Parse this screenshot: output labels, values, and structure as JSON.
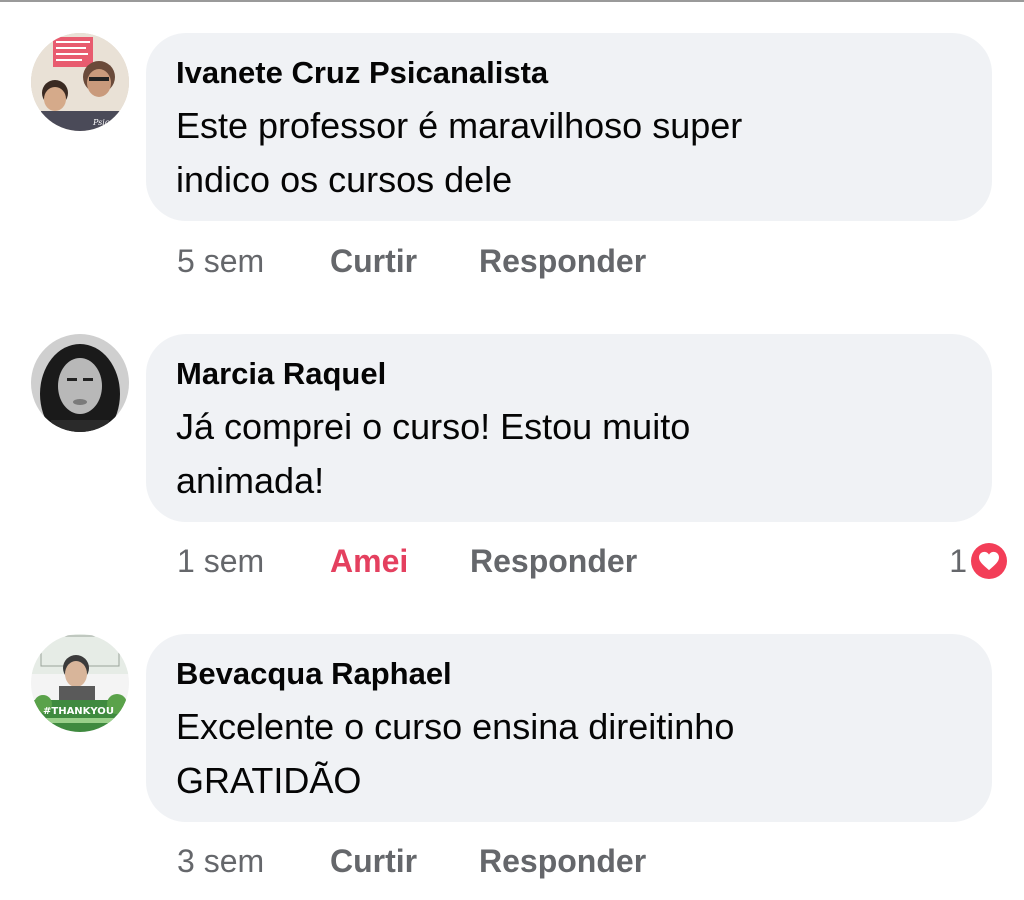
{
  "comments": [
    {
      "author": "Ivanete Cruz Psicanalista",
      "text_line1": "Este professor é maravilhoso super",
      "text_line2": "indico os cursos dele",
      "time": "5 sem",
      "like_label": "Curtir",
      "reply_label": "Responder"
    },
    {
      "author": "Marcia Raquel",
      "text_line1": "Já comprei o curso! Estou muito",
      "text_line2": "animada!",
      "time": "1 sem",
      "like_label": "Amei",
      "like_color": "#e4405f",
      "reply_label": "Responder",
      "reaction_count": "1",
      "reaction_icon": "heart-icon"
    },
    {
      "author": "Bevacqua Raphael",
      "text_line1": "Excelente o curso ensina direitinho",
      "text_line2": "GRATIDÃO",
      "time": "3 sem",
      "like_label": "Curtir",
      "reply_label": "Responder"
    }
  ],
  "colors": {
    "bubble": "#f0f2f5",
    "meta_text": "#65676b",
    "love_reaction": "#e4405f"
  }
}
